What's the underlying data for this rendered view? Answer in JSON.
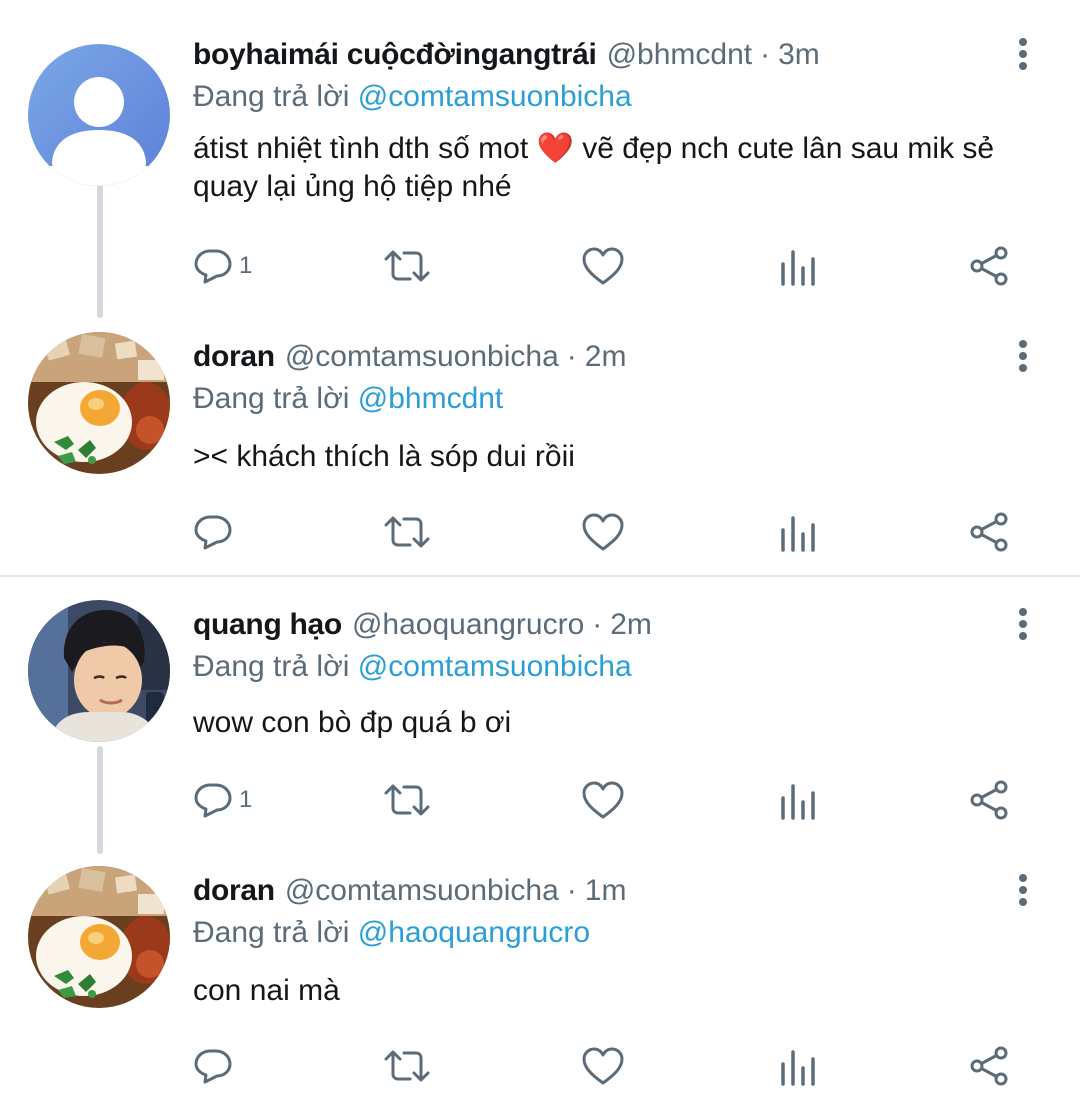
{
  "tweets": [
    {
      "name": "boyhaimái cuộcđờingangtrái",
      "handle": "@bhmcdnt",
      "dot": "·",
      "time": "3m",
      "replying_prefix": "Đang trả lời ",
      "replying_to": "@comtamsuonbicha",
      "text": "átist nhiệt tình dth số mot ❤️ vẽ đẹp nch cute lân sau mik sẻ quay lại ủng hộ tiệp nhé",
      "reply_count": "1",
      "avatar": "default-avatar"
    },
    {
      "name": "doran",
      "handle": "@comtamsuonbicha",
      "dot": "·",
      "time": "2m",
      "replying_prefix": "Đang trả lời ",
      "replying_to": "@bhmcdnt",
      "text": ">< khách thích là sóp dui rồii",
      "reply_count": "",
      "avatar": "food-photo-avatar"
    },
    {
      "name": "quang hạo",
      "handle": "@haoquangrucro",
      "dot": "·",
      "time": "2m",
      "replying_prefix": "Đang trả lời ",
      "replying_to": "@comtamsuonbicha",
      "text": "wow con bò đp quá b ơi",
      "reply_count": "1",
      "avatar": "person-photo-avatar"
    },
    {
      "name": "doran",
      "handle": "@comtamsuonbicha",
      "dot": "·",
      "time": "1m",
      "replying_prefix": "Đang trả lời ",
      "replying_to": "@haoquangrucro",
      "text": "con nai mà",
      "reply_count": "",
      "avatar": "food-photo-avatar"
    }
  ],
  "icons": [
    "reply-icon",
    "retweet-icon",
    "like-icon",
    "analytics-icon",
    "share-icon",
    "more-options-icon"
  ],
  "colors": {
    "link": "#2a9fd6",
    "muted": "#5b6b78",
    "text": "#14171a",
    "thread_line": "#d4d8dc",
    "divider": "#e6e9ec"
  }
}
